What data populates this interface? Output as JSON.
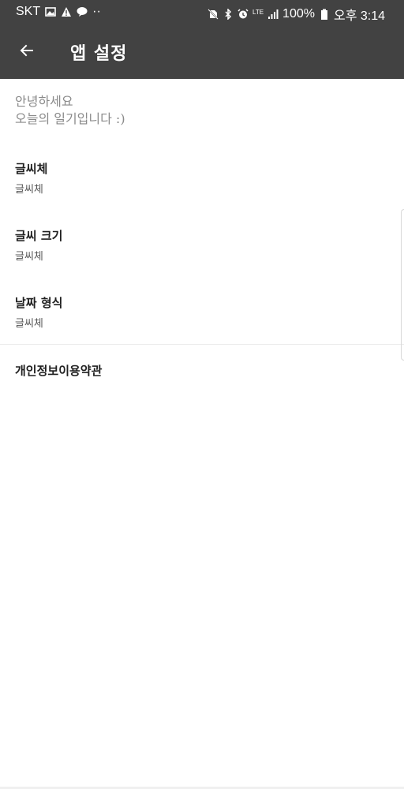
{
  "status_bar": {
    "carrier": "SKT",
    "notification_icons": [
      "image-icon",
      "warning-icon",
      "talk-icon"
    ],
    "more_dots": "··",
    "network_label": "LTE",
    "battery_percent": "100%",
    "time": "오후 3:14"
  },
  "app_bar": {
    "title": "앱 설정",
    "background": "#424242"
  },
  "intro": {
    "line1": "안녕하세요",
    "line2": "오늘의 일기입니다 :)"
  },
  "settings": [
    {
      "title": "글씨체",
      "summary": "글씨체"
    },
    {
      "title": "글씨 크기",
      "summary": "글씨체"
    },
    {
      "title": "날짜 형식",
      "summary": "글씨체"
    }
  ],
  "privacy": {
    "label": "개인정보이용약관"
  }
}
